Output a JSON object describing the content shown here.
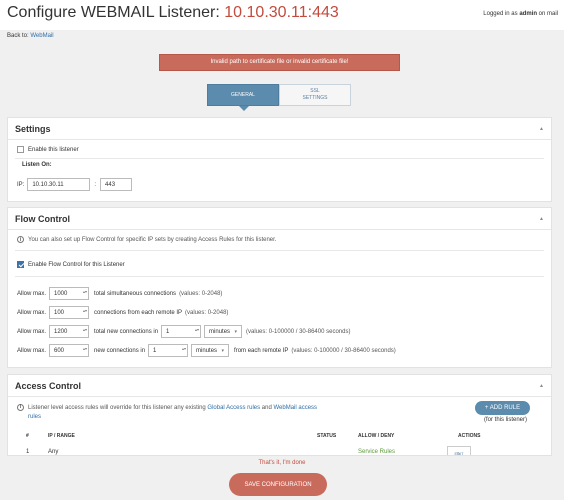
{
  "header": {
    "title_prefix": "Configure WEBMAIL Listener: ",
    "title_ip": "10.10.30.11:443",
    "login_prefix": "Logged in as ",
    "login_user": "admin",
    "login_suffix": " on mail"
  },
  "back": {
    "prefix": "Back to: ",
    "link": "WebMail"
  },
  "error_banner": "Invalid path to certificate file or invalid certificate file!",
  "tabs": [
    {
      "label": "GENERAL",
      "active": true
    },
    {
      "label": "SSL SETTINGS",
      "active": false
    }
  ],
  "settings": {
    "title": "Settings",
    "enable_label": "Enable this listener",
    "listen_on_label": "Listen On:",
    "ip_label": "IP:",
    "ip_value": "10.10.30.11",
    "port_separator": ":",
    "port_value": "443"
  },
  "flow_control": {
    "title": "Flow Control",
    "info_text": "You can also set up Flow Control for specific IP sets by creating Access Rules for this listener.",
    "enable_label": "Enable Flow Control for this Listener",
    "rows": [
      {
        "allow": "Allow max.",
        "value": "1000",
        "label": "total simultaneous connections",
        "range": "(values: 0-2048)"
      },
      {
        "allow": "Allow max.",
        "value": "100",
        "label": "connections from each remote IP",
        "range": "(values: 0-2048)"
      },
      {
        "allow": "Allow max.",
        "value": "1200",
        "label": "total new connections in",
        "interval": "1",
        "unit": "minutes",
        "range": "(values: 0-100000 / 30-86400 seconds)"
      },
      {
        "allow": "Allow max.",
        "value": "600",
        "label": "new connections in",
        "interval": "1",
        "unit": "minutes",
        "suffix": "from each remote IP",
        "range": "(values: 0-100000 / 30-86400 seconds)"
      }
    ]
  },
  "access_control": {
    "title": "Access Control",
    "info_prefix": "Listener level access rules will override for this listener any existing ",
    "info_link1": "Global Access rules",
    "info_mid": " and ",
    "info_link2": "WebMail access rules",
    "add_rule_label": "+ ADD RULE",
    "add_rule_note": "(for this listener)",
    "columns": [
      "#",
      "IP / RANGE",
      "STATUS",
      "ALLOW / DENY",
      "ACTIONS"
    ],
    "rows": [
      {
        "num": "1",
        "ip": "Any",
        "status": "",
        "allow": "Service Rules",
        "action": "EDIT"
      }
    ]
  },
  "footer": {
    "done_text": "That's it, I'm done",
    "save_label": "SAVE CONFIGURATION"
  },
  "colors": {
    "accent": "#5b8bad",
    "error": "#c96b5c",
    "link": "#2f6ea6"
  }
}
